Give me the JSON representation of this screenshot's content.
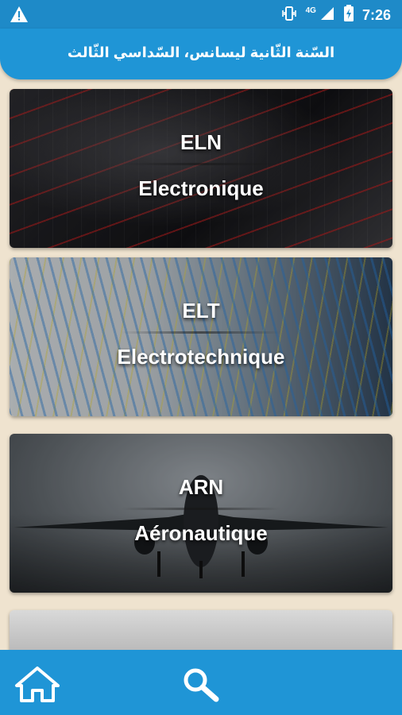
{
  "status_bar": {
    "time": "7:26",
    "network": "4G",
    "icons": [
      "warning-icon",
      "vibrate-icon",
      "signal-icon",
      "battery-charging-icon"
    ]
  },
  "header": {
    "title": "السّنة الثّانية ليسانس، السّداسي الثّالث"
  },
  "specialties": [
    {
      "code": "ELN",
      "name": "Electronique"
    },
    {
      "code": "ELT",
      "name": "Electrotechnique"
    },
    {
      "code": "ARN",
      "name": "Aéronautique"
    }
  ],
  "bottom_nav": {
    "icons": [
      "home-icon",
      "search-icon"
    ]
  },
  "colors": {
    "primary": "#1f95d6",
    "background": "#efe3cf",
    "text": "#ffffff"
  }
}
